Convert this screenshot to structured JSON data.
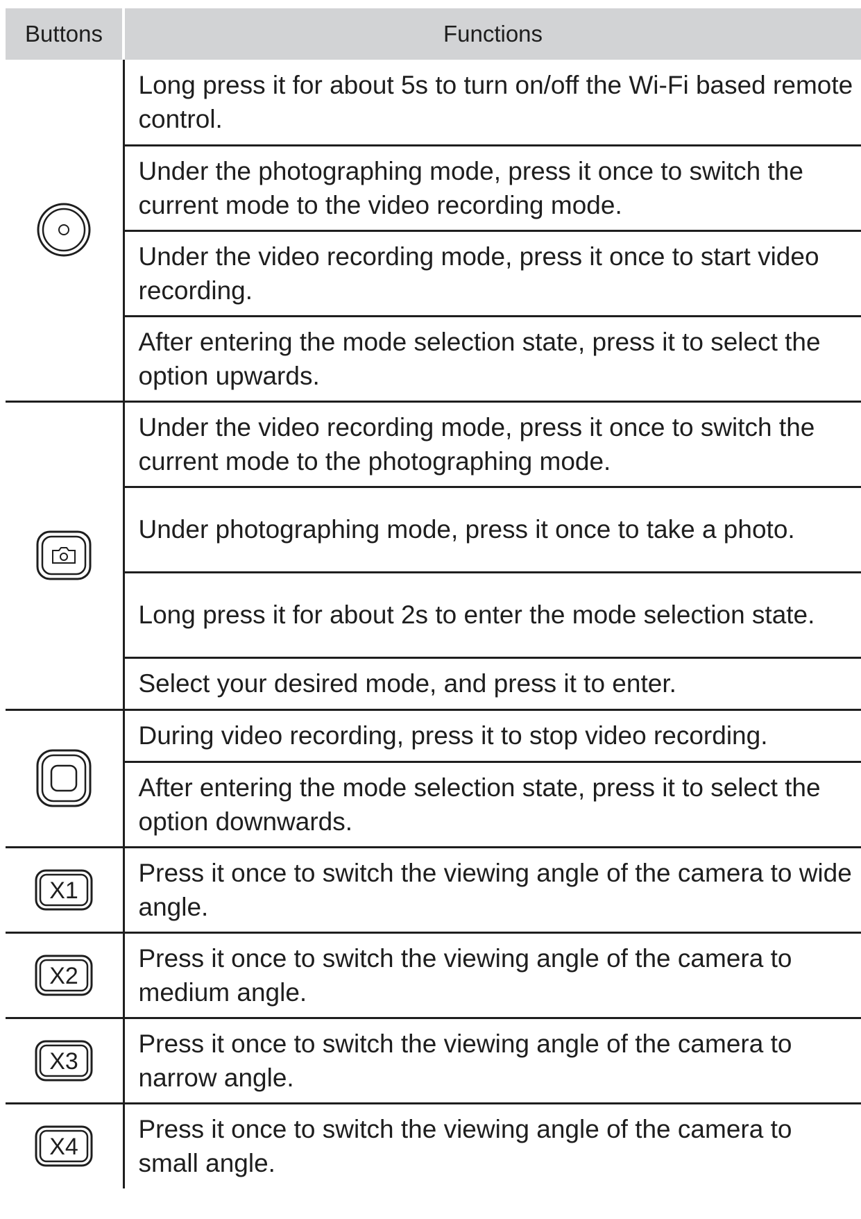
{
  "table": {
    "headers": {
      "buttons": "Buttons",
      "functions": "Functions"
    },
    "groups": [
      {
        "icon": "power-button-icon",
        "functions": [
          "Long press it for about 5s to turn on/off the Wi-Fi based remote control.",
          "Under the photographing mode, press it once to switch the current mode to the video recording mode.",
          "Under the video recording mode, press it once to start video recording.",
          "After entering the mode selection state, press it to select the option upwards."
        ]
      },
      {
        "icon": "camera-button-icon",
        "functions": [
          "Under the video recording mode, press it once to switch the current mode to the photographing mode.",
          "Under photographing mode, press it once to take a photo.",
          "Long press it for about 2s to enter the mode selection state.",
          "Select your desired mode, and press it to enter."
        ]
      },
      {
        "icon": "stop-button-icon",
        "functions": [
          "During video recording, press it to stop video recording.",
          "After entering the mode selection state, press it to select the option downwards."
        ]
      },
      {
        "icon": "x1-button-icon",
        "label": "X1",
        "functions": [
          "Press it once to switch the viewing angle of the camera to wide angle."
        ]
      },
      {
        "icon": "x2-button-icon",
        "label": "X2",
        "functions": [
          "Press it once to switch the viewing angle of the camera to medium angle."
        ]
      },
      {
        "icon": "x3-button-icon",
        "label": "X3",
        "functions": [
          "Press it once to switch the viewing angle of the camera to narrow angle."
        ]
      },
      {
        "icon": "x4-button-icon",
        "label": "X4",
        "functions": [
          "Press it once to switch the viewing angle of the camera to small angle."
        ]
      }
    ]
  }
}
